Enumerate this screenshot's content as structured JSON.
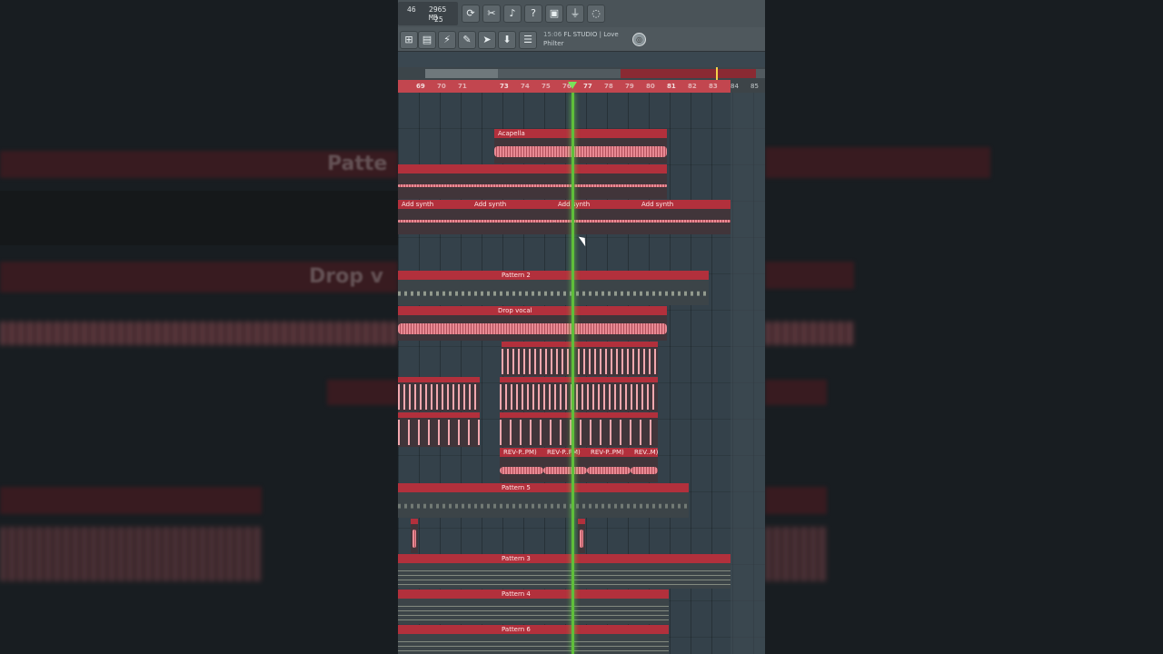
{
  "toolbar": {
    "cpu_value": "46",
    "memory_value": "2965 MB",
    "polyphony_value": "25",
    "buttons": [
      {
        "name": "loop-icon",
        "glyph": "⟳"
      },
      {
        "name": "cut-icon",
        "glyph": "✂"
      },
      {
        "name": "mic-icon",
        "glyph": "🎙"
      },
      {
        "name": "help-icon",
        "glyph": "?"
      },
      {
        "name": "save-icon",
        "glyph": "💾"
      },
      {
        "name": "plugin-icon",
        "glyph": "🔌"
      },
      {
        "name": "chat-icon",
        "glyph": "💬"
      }
    ],
    "buttons2": [
      {
        "name": "file-icon",
        "glyph": "📄"
      },
      {
        "name": "plug-icon",
        "glyph": "⚡"
      },
      {
        "name": "brush-icon",
        "glyph": "✎"
      },
      {
        "name": "arrow-icon",
        "glyph": "➤"
      },
      {
        "name": "download-icon",
        "glyph": "⬇"
      },
      {
        "name": "mixer-icon",
        "glyph": "☰"
      }
    ],
    "hint_time": "15:06",
    "hint_text": "FL STUDIO | Love Philter"
  },
  "ruler": {
    "bars": [
      "69",
      "70",
      "71",
      "73",
      "74",
      "75",
      "76",
      "77",
      "78",
      "79",
      "80",
      "81",
      "82",
      "83",
      "84",
      "85"
    ]
  },
  "clips": {
    "acapella": "Acapella",
    "add_synth": "Add synth",
    "pattern2": "Pattern 2",
    "drop_vocal": "Drop vocal",
    "rev": "REV-P..PM)",
    "rev_last": "REV..M)",
    "pattern5": "Pattern 5",
    "pattern3": "Pattern 3",
    "pattern4": "Pattern 4",
    "pattern6": "Pattern 6"
  },
  "background_text": {
    "left_top": "Patte",
    "left_mid": "Drop v"
  }
}
